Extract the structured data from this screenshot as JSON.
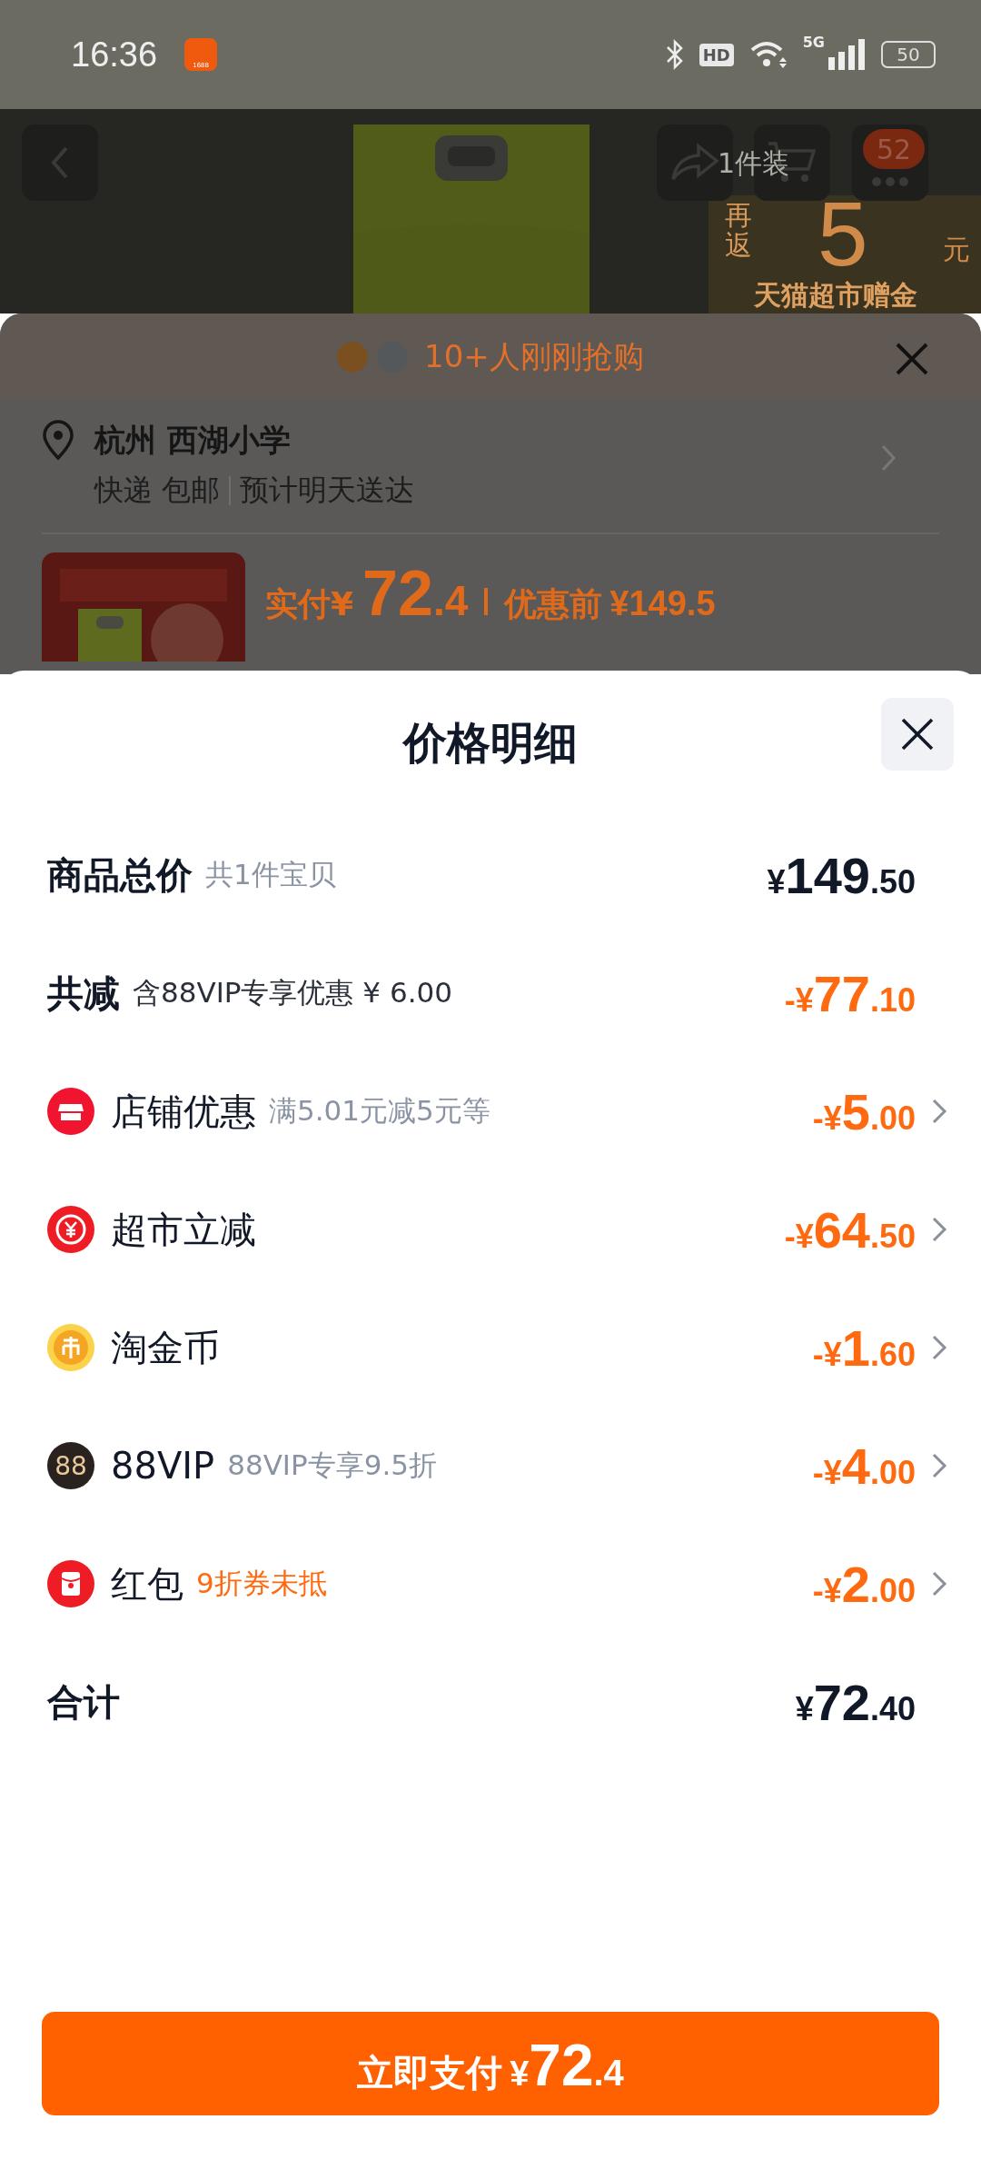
{
  "status_bar": {
    "time": "16:36",
    "app_badge": "1688",
    "hd": "HD",
    "network": "5G",
    "battery": "50"
  },
  "product_header": {
    "cart_badge": "52",
    "size_label": "1件装",
    "promo": {
      "prefix": "再返",
      "amount": "5",
      "unit": "元",
      "caption": "天猫超市赠金"
    }
  },
  "order_sheet": {
    "social_proof": "10+人刚刚抢购",
    "address": "杭州 西湖小学",
    "shipping": "快递 包邮",
    "eta": "预计明天送达",
    "paid_label": "实付",
    "paid_currency": "¥",
    "paid_main": "72",
    "paid_fraction": ".4",
    "before_label": "优惠前",
    "before_amount": "¥149.5"
  },
  "price_detail": {
    "title": "价格明细",
    "rows": [
      {
        "kind": "total",
        "label": "商品总价",
        "note": "共1件宝贝",
        "amount": {
          "prefix": "¥",
          "main": "149",
          "fraction": ".50"
        }
      },
      {
        "kind": "reduction",
        "label": "共减",
        "note": "含88VIP专享优惠 ¥ 6.00",
        "amount": {
          "prefix": "-¥",
          "main": "77",
          "fraction": ".10"
        }
      },
      {
        "kind": "item",
        "label": "店铺优惠",
        "note": "满5.01元减5元等",
        "note_emphasis": false,
        "amount": {
          "prefix": "-¥",
          "main": "5",
          "fraction": ".00"
        }
      },
      {
        "kind": "item",
        "label": "超市立减",
        "amount": {
          "prefix": "-¥",
          "main": "64",
          "fraction": ".50"
        }
      },
      {
        "kind": "item",
        "label": "淘金币",
        "amount": {
          "prefix": "-¥",
          "main": "1",
          "fraction": ".60"
        }
      },
      {
        "kind": "item",
        "label": "88VIP",
        "icon_text": "88",
        "note": "88VIP专享9.5折",
        "note_emphasis": false,
        "amount": {
          "prefix": "-¥",
          "main": "4",
          "fraction": ".00"
        }
      },
      {
        "kind": "item",
        "label": "红包",
        "note": "9折券未抵",
        "note_emphasis": true,
        "amount": {
          "prefix": "-¥",
          "main": "2",
          "fraction": ".00"
        }
      },
      {
        "kind": "sum",
        "label": "合计",
        "amount": {
          "prefix": "¥",
          "main": "72",
          "fraction": ".40"
        }
      }
    ]
  },
  "pay_button": {
    "label": "立即支付",
    "prefix": "¥",
    "main": "72",
    "fraction": ".4"
  }
}
